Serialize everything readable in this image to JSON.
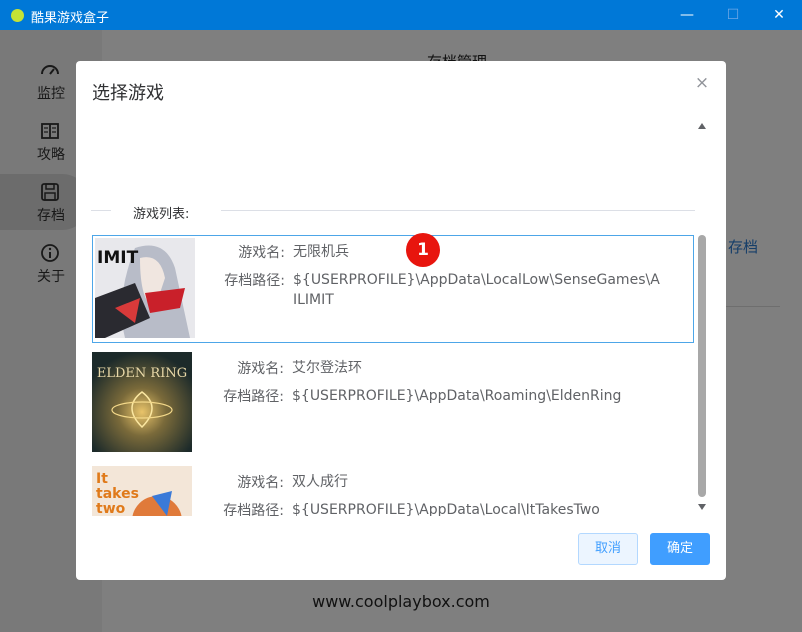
{
  "window": {
    "title": "酷果游戏盒子",
    "minimize_glyph": "—",
    "maximize_glyph": "☐",
    "close_glyph": "✕"
  },
  "sidebar": {
    "items": [
      {
        "label": "监控",
        "icon": "gauge-icon"
      },
      {
        "label": "攻略",
        "icon": "book-icon"
      },
      {
        "label": "存档",
        "icon": "save-icon",
        "active": true
      },
      {
        "label": "关于",
        "icon": "info-icon"
      }
    ]
  },
  "content": {
    "title": "存档管理",
    "link": "存档"
  },
  "dialog": {
    "title": "选择游戏",
    "close_glyph": "×",
    "list_label": "游戏列表:",
    "games": [
      {
        "name_label": "游戏名:",
        "name": "无限机兵",
        "path_label": "存档路径:",
        "path": "${USERPROFILE}\\AppData\\LocalLow\\SenseGames\\AILIMIT",
        "cover_text": "IMIT",
        "selected": true
      },
      {
        "name_label": "游戏名:",
        "name": "艾尔登法环",
        "path_label": "存档路径:",
        "path": "${USERPROFILE}\\AppData\\Roaming\\EldenRing",
        "cover_text": "ELDEN RING"
      },
      {
        "name_label": "游戏名:",
        "name": "双人成行",
        "path_label": "存档路径:",
        "path": "${USERPROFILE}\\AppData\\Local\\ItTakesTwo",
        "cover_text": "It takes two"
      }
    ],
    "cancel_label": "取消",
    "ok_label": "确定"
  },
  "badge": "1",
  "footer": "www.coolplaybox.com",
  "colors": {
    "titlebar": "#0078d7",
    "primary": "#409eff",
    "badge": "#e8150e"
  }
}
